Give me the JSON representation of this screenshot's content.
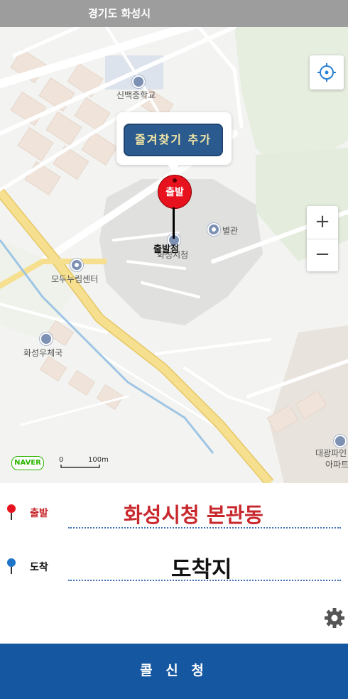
{
  "header": {
    "title": "경기도 화성시"
  },
  "map": {
    "pois": {
      "school": "신백중학교",
      "annex": "별관",
      "center": "모두누림센터",
      "post_office": "화성우체국",
      "city_hall": "화성시청",
      "apartment_line1": "대광파인",
      "apartment_line2": "아파트"
    },
    "favorite_button": "즐겨찾기 추가",
    "start_pin_label": "출발",
    "start_point_label": "출발점",
    "naver_logo": "NAVER",
    "scale": {
      "zero": "0",
      "distance": "100m"
    },
    "zoom": {
      "plus": "+",
      "minus": "−"
    }
  },
  "route": {
    "start_label": "출발",
    "start_value": "화성시청 본관동",
    "dest_label": "도착",
    "dest_value": "도착지"
  },
  "colors": {
    "start": "#e8111e",
    "dest": "#1e74c6",
    "start_text": "#c8282d",
    "call_button": "#1557a0",
    "road_yellow": "#f6df8e"
  },
  "icons": {
    "locate": "crosshair-icon",
    "settings": "gear-icon"
  },
  "call_button": "콜 신 청"
}
